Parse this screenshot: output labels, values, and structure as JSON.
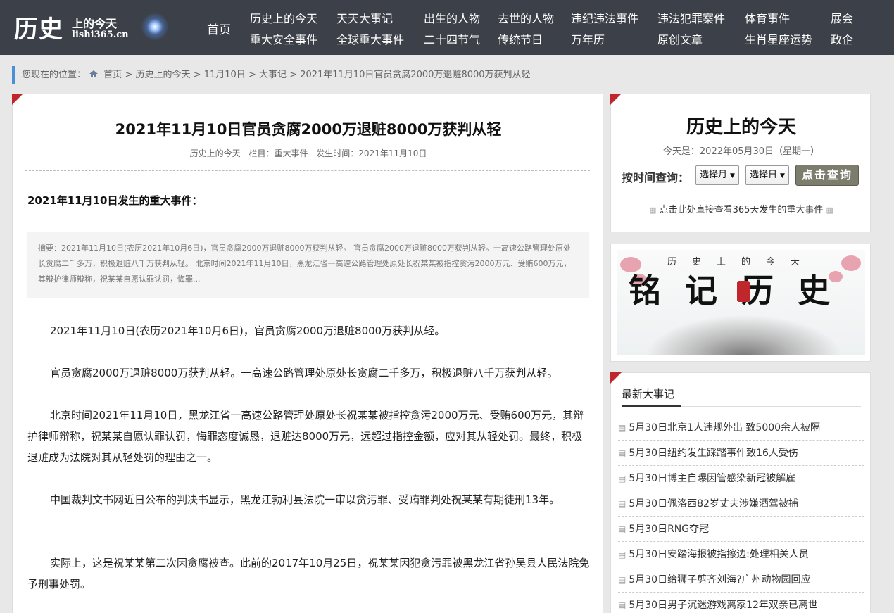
{
  "header": {
    "logo_big": "历史",
    "logo_small": "上的今天",
    "logo_url": "lishi365.cn",
    "nav_home": "首页",
    "nav": [
      "历史上的今天",
      "重大安全事件",
      "天天大事记",
      "全球重大事件",
      "出生的人物",
      "二十四节气",
      "去世的人物",
      "传统节日",
      "违纪违法事件",
      "万年历",
      "违法犯罪案件",
      "原创文章",
      "体育事件",
      "生肖星座运势",
      "展会",
      "政企"
    ]
  },
  "breadcrumb": {
    "prefix": "您现在的位置：",
    "items": [
      "首页",
      "历史上的今天",
      "11月10日",
      "大事记",
      "2021年11月10日官员贪腐2000万退赃8000万获判从轻"
    ],
    "sep": ">"
  },
  "article": {
    "title": "2021年11月10日官员贪腐2000万退赃8000万获判从轻",
    "meta_source": "历史上的今天",
    "meta_column": "栏目：重大事件",
    "meta_time": "发生时间：2021年11月10日",
    "subhead": "2021年11月10日发生的重大事件：",
    "summary": "摘要：2021年11月10日(农历2021年10月6日)，官员贪腐2000万退赃8000万获判从轻。 官员贪腐2000万退赃8000万获判从轻。一高速公路管理处原处长贪腐二千多万，积极退赃八千万获判从轻。 北京时间2021年11月10日，黑龙江省一高速公路管理处原处长祝某某被指控贪污2000万元、受贿600万元，其辩护律师辩称，祝某某自愿认罪认罚，悔罪...",
    "paragraphs": [
      "2021年11月10日(农历2021年10月6日)，官员贪腐2000万退赃8000万获判从轻。",
      "官员贪腐2000万退赃8000万获判从轻。一高速公路管理处原处长贪腐二千多万，积极退赃八千万获判从轻。",
      "北京时间2021年11月10日，黑龙江省一高速公路管理处原处长祝某某被指控贪污2000万元、受贿600万元，其辩护律师辩称，祝某某自愿认罪认罚，悔罪态度诚恳，退赃达8000万元，远超过指控金额，应对其从轻处罚。最终，积极退赃成为法院对其从轻处罚的理由之一。",
      "中国裁判文书网近日公布的判决书显示，黑龙江勃利县法院一审以贪污罪、受贿罪判处祝某某有期徒刑13年。",
      "实际上，这是祝某某第二次因贪腐被查。此前的2017年10月25日，祝某某因犯贪污罪被黑龙江省孙吴县人民法院免予刑事处罚。"
    ]
  },
  "sidebar": {
    "title": "历史上的今天",
    "today": "今天是：2022年05月30日（星期一）",
    "query_label": "按时间查询：",
    "month_select": "选择月",
    "day_select": "选择日",
    "query_button": "点击查询",
    "link_365": "点击此处直接查看365天发生的重大事件",
    "banner_top": "历史上的今天",
    "banner_main": "铭记历史",
    "news_title": "最新大事记",
    "news": [
      "5月30日北京1人违规外出 致5000余人被隔",
      "5月30日纽约发生踩踏事件致16人受伤",
      "5月30日博主自曝因管感染新冠被解雇",
      "5月30日佩洛西82岁丈夫涉嫌酒驾被捕",
      "5月30日RNG夺冠",
      "5月30日安踏海报被指擦边:处理相关人员",
      "5月30日给狮子剪齐刘海?广州动物园回应",
      "5月30日男子沉迷游戏离家12年双亲已离世"
    ]
  },
  "colors": {
    "header_bg": "#3c4149",
    "accent_red": "#c0272d",
    "breadcrumb_bar": "#4a90d9"
  }
}
